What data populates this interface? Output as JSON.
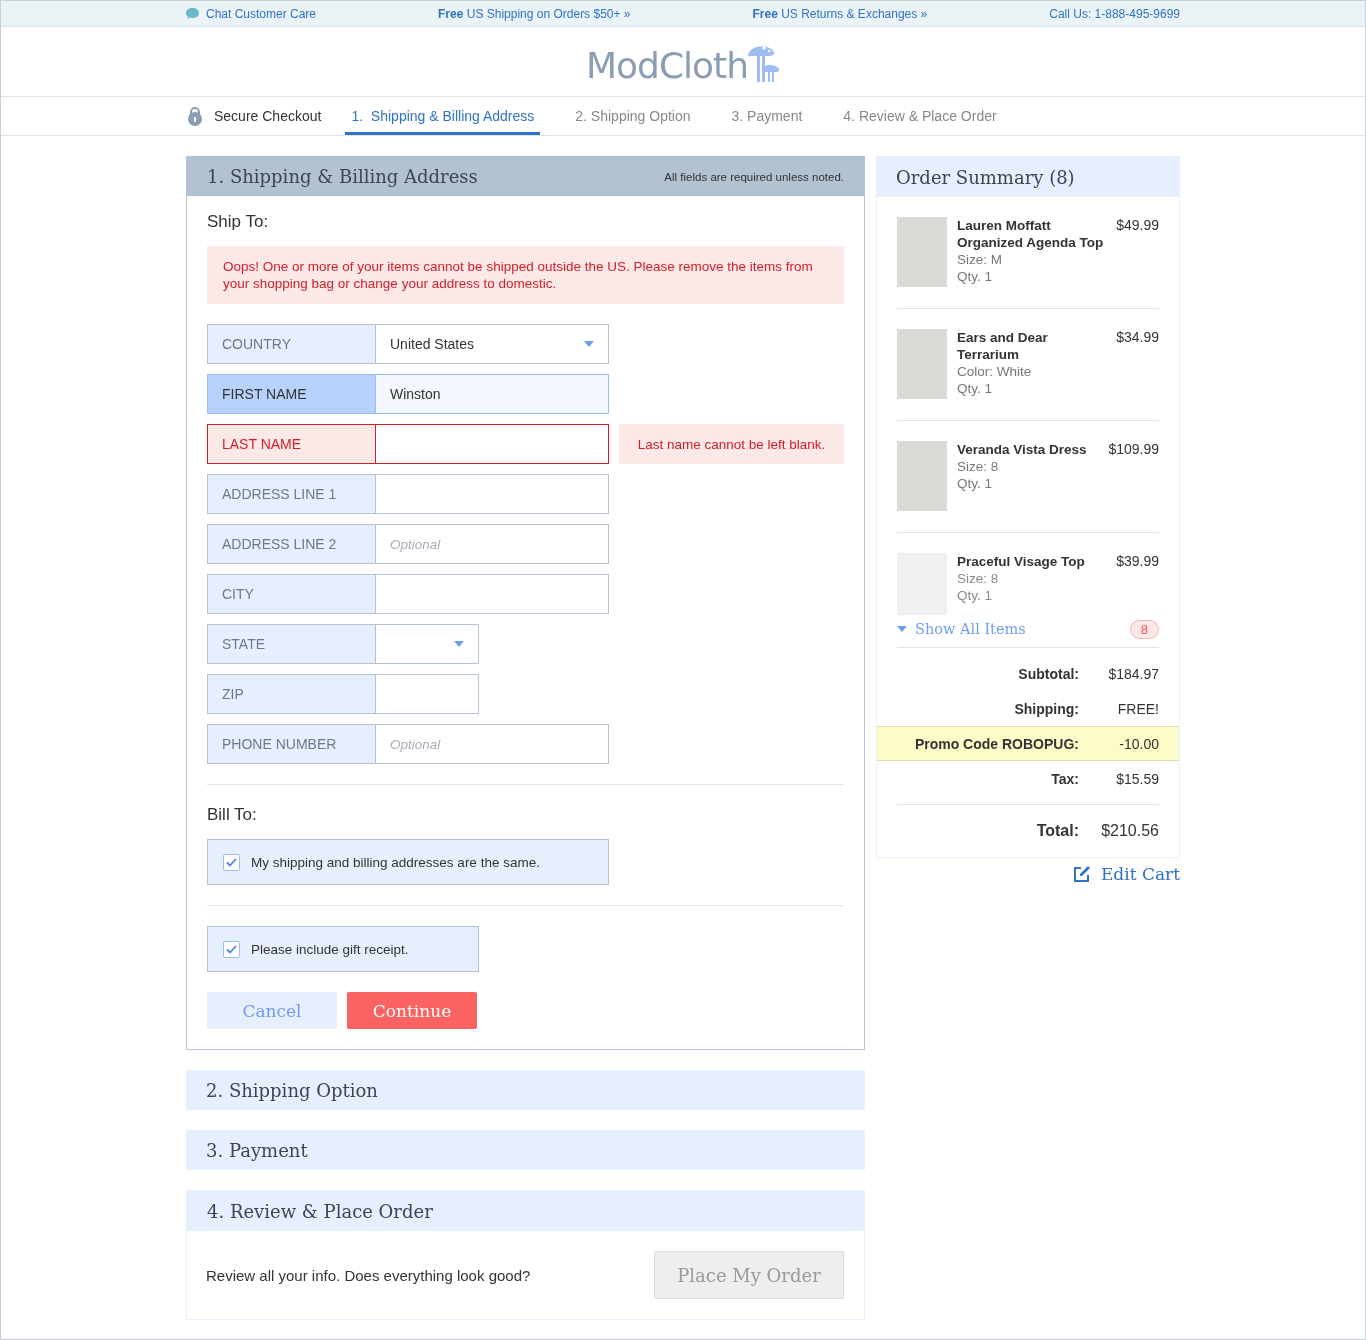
{
  "top_bar": {
    "chat": "Chat Customer Care",
    "promos": [
      {
        "bold": "Free",
        "text": "US Shipping on Orders $50+ »"
      },
      {
        "bold": "Free",
        "text": "US Returns & Exchanges »"
      }
    ],
    "phone": "Call Us: 1-888-495-9699"
  },
  "logo": "ModCloth",
  "steps": {
    "secure": "Secure Checkout",
    "tabs": [
      {
        "label": "1.  Shipping & Billing Address",
        "selected": true
      },
      {
        "label": "2. Shipping Option",
        "selected": false
      },
      {
        "label": "3. Payment",
        "selected": false
      },
      {
        "label": "4. Review & Place Order",
        "selected": false
      }
    ]
  },
  "address_section": {
    "title": "1. Shipping & Billing Address",
    "note": "All fields are required unless noted.",
    "ship_to": "Ship To:",
    "alert": "Oops! One or more of your items cannot be shipped outside the US. Please remove the items from your shopping bag or change your address to domestic.",
    "fields": [
      {
        "label": "COUNTRY",
        "kind": "select",
        "value": "United States",
        "focused": false,
        "invalid": false,
        "compact": false
      },
      {
        "label": "FIRST NAME",
        "kind": "text",
        "value": "Winston",
        "focused": true,
        "invalid": false,
        "compact": false
      },
      {
        "label": "LAST NAME",
        "kind": "text",
        "focused": false,
        "invalid": true,
        "error": "Last name cannot be left blank.",
        "compact": false
      },
      {
        "label": "ADDRESS LINE 1",
        "kind": "text",
        "focused": false,
        "invalid": false,
        "compact": false
      },
      {
        "label": "ADDRESS LINE 2",
        "kind": "text",
        "placeholder": "Optional",
        "focused": false,
        "invalid": false,
        "compact": false
      },
      {
        "label": "CITY",
        "kind": "text",
        "focused": false,
        "invalid": false,
        "compact": false
      },
      {
        "label": "STATE",
        "kind": "select",
        "focused": false,
        "invalid": false,
        "compact": true
      },
      {
        "label": "ZIP",
        "kind": "text",
        "focused": false,
        "invalid": false,
        "compact": true
      },
      {
        "label": "PHONE NUMBER",
        "kind": "text",
        "placeholder": "Optional",
        "focused": false,
        "invalid": false,
        "compact": false
      }
    ],
    "bill_to": "Bill To:",
    "checkboxes": [
      {
        "label": "My shipping and billing addresses are the same.",
        "checked": true,
        "compact": false
      },
      {
        "label": "Please include gift receipt.",
        "checked": true,
        "compact": true
      }
    ],
    "cancel": "Cancel",
    "continue": "Continue"
  },
  "collapsed_sections": [
    "2. Shipping Option",
    "3. Payment"
  ],
  "review_section": {
    "title": "4. Review & Place Order",
    "text": "Review all your info. Does everything look good?",
    "button": "Place My Order",
    "disabled": true
  },
  "summary": {
    "title": "Order Summary (8)",
    "items": [
      {
        "name": "Lauren Moffatt Organized Agenda Top",
        "details": [
          "Size: M",
          "Qty. 1"
        ],
        "price": "$49.99",
        "faded": false
      },
      {
        "name": "Ears and Dear Terrarium",
        "details": [
          "Color: White",
          "Qty. 1"
        ],
        "price": "$34.99",
        "faded": false
      },
      {
        "name": "Veranda Vista Dress",
        "details": [
          "Size: 8",
          "Qty. 1"
        ],
        "price": "$109.99",
        "faded": false
      },
      {
        "name": "Praceful Visage Top",
        "details": [
          "Size: 8",
          "Qty. 1"
        ],
        "price": "$39.99",
        "faded": true
      }
    ],
    "show_all": "Show All Items",
    "count": "8",
    "totals": [
      {
        "label": "Subtotal:",
        "value": "$184.97",
        "highlighted": false
      },
      {
        "label": "Shipping:",
        "value": "FREE!",
        "highlighted": false
      },
      {
        "label": "Promo Code ROBOPUG:",
        "value": "-10.00",
        "highlighted": true
      },
      {
        "label": "Tax:",
        "value": "$15.59",
        "highlighted": false
      }
    ],
    "total_label": "Total:",
    "total": "$210.56",
    "edit_cart": "Edit Cart"
  }
}
